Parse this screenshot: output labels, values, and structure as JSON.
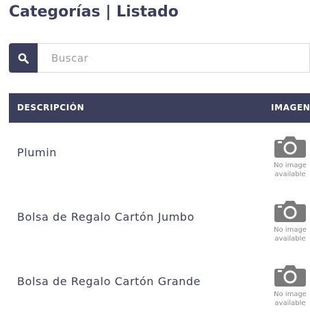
{
  "page": {
    "title": "Categorías | Listado"
  },
  "search": {
    "placeholder": "Buscar",
    "icon": "search-icon"
  },
  "table": {
    "columns": [
      "DESCRIPCIÓN",
      "IMAGEN"
    ],
    "header_color": "#3b3f5c",
    "rows": [
      {
        "description": "Plumin",
        "image_text_1": "No image",
        "image_text_2": "available"
      },
      {
        "description": "Bolsa de Regalo Cartón Jumbo",
        "image_text_1": "No image",
        "image_text_2": "available"
      },
      {
        "description": "Bolsa de Regalo Cartón Grande",
        "image_text_1": "No image",
        "image_text_2": "available"
      }
    ]
  }
}
